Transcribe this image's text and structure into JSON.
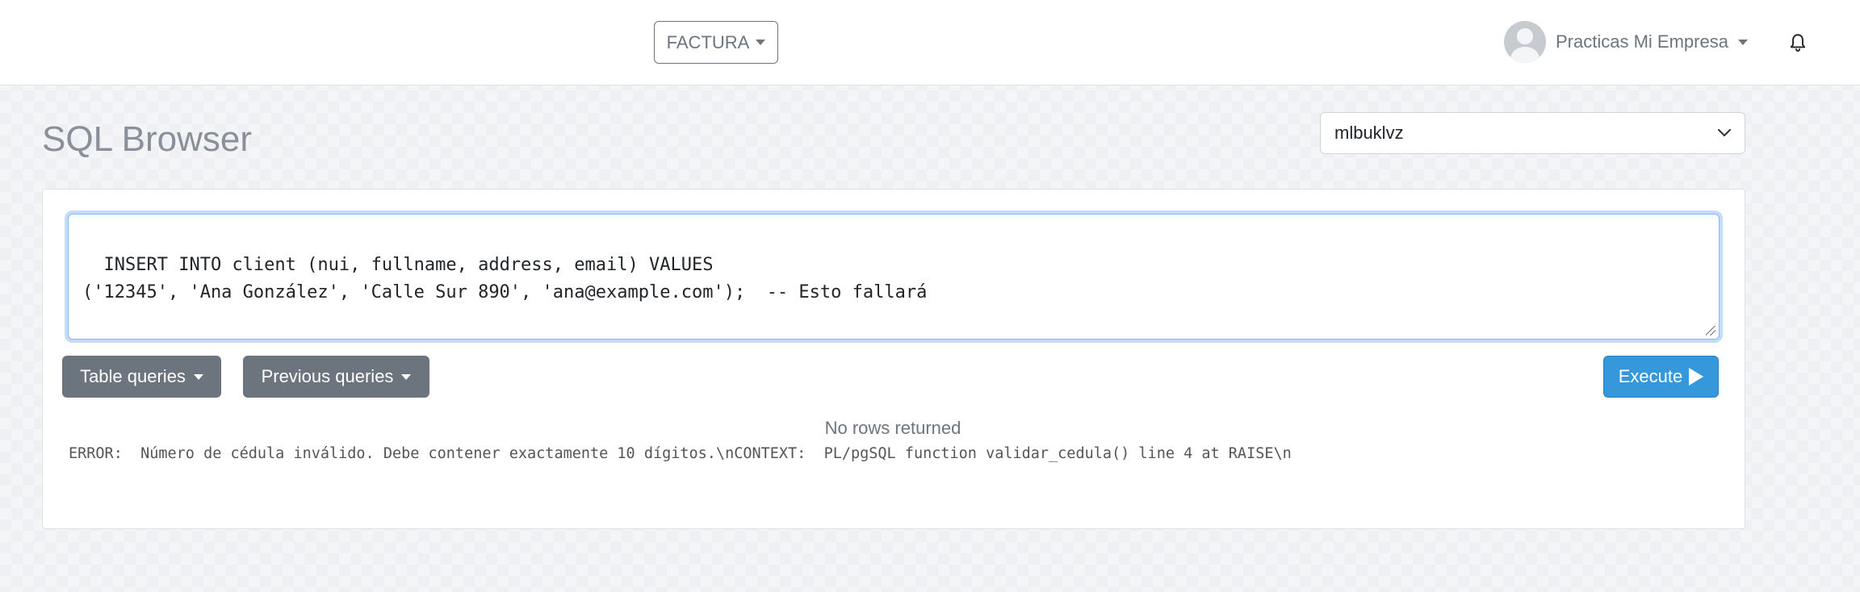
{
  "navbar": {
    "module_dropdown_label": "FACTURA",
    "user_name": "Practicas Mi Empresa"
  },
  "page": {
    "title": "SQL Browser"
  },
  "database_select": {
    "value": "mlbuklvz"
  },
  "editor": {
    "query": "INSERT INTO client (nui, fullname, address, email) VALUES\n('12345', 'Ana González', 'Calle Sur 890', 'ana@example.com');  -- Esto fallará"
  },
  "toolbar": {
    "table_queries_label": "Table queries",
    "previous_queries_label": "Previous queries",
    "execute_label": "Execute"
  },
  "result": {
    "status": "No rows returned",
    "error": "ERROR:  Número de cédula inválido. Debe contener exactamente 10 dígitos.\\nCONTEXT:  PL/pgSQL function validar_cedula() line 4 at RAISE\\n"
  },
  "colors": {
    "primary_execute": "#3498db",
    "secondary_button": "#6c757d",
    "editor_focus": "#86b7fe"
  },
  "icons": [
    "caret-down-icon",
    "user-avatar-icon",
    "bell-icon",
    "chevron-down-icon",
    "play-icon"
  ]
}
